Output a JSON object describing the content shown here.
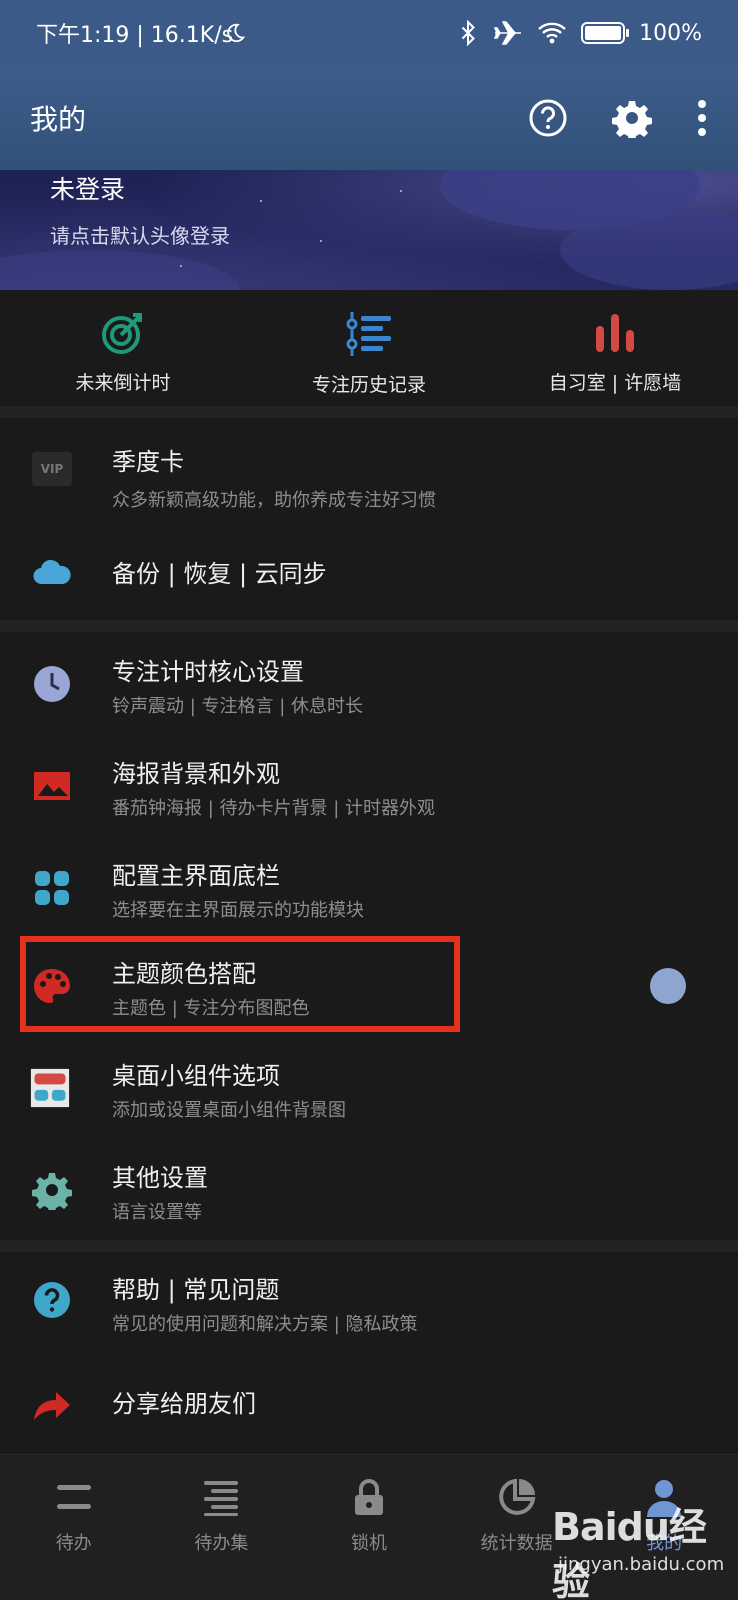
{
  "status_bar": {
    "left_text": "下午1:19 | 16.1K/s",
    "battery_text": "100%",
    "battery_level": 1.0
  },
  "app_bar": {
    "title": "我的",
    "icons": [
      "help-circle-icon",
      "settings-gear-icon",
      "more-vert-icon"
    ]
  },
  "profile": {
    "title": "未登录",
    "subtitle": "请点击默认头像登录"
  },
  "quick_actions": [
    {
      "label": "未来倒计时",
      "icon": "target-icon",
      "color": "#1e9a7a"
    },
    {
      "label": "专注历史记录",
      "icon": "timeline-list-icon",
      "color": "#3b86d1"
    },
    {
      "label": "自习室 | 许愿墙",
      "icon": "bar-chart-icon",
      "color": "#d24a42"
    }
  ],
  "group1": [
    {
      "title": "季度卡",
      "subtitle": "众多新颖高级功能，助你养成专注好习惯",
      "icon": "vip-icon"
    },
    {
      "title": "备份 | 恢复 | 云同步",
      "subtitle": "",
      "icon": "cloud-icon"
    }
  ],
  "group2": [
    {
      "title": "专注计时核心设置",
      "subtitle": "铃声震动 | 专注格言 | 休息时长",
      "icon": "clock-icon"
    },
    {
      "title": "海报背景和外观",
      "subtitle": "番茄钟海报 | 待办卡片背景 | 计时器外观",
      "icon": "image-icon"
    },
    {
      "title": "配置主界面底栏",
      "subtitle": "选择要在主界面展示的功能模块",
      "icon": "grid-icon"
    },
    {
      "title": "主题颜色搭配",
      "subtitle": "主题色 | 专注分布图配色",
      "icon": "palette-icon"
    },
    {
      "title": "桌面小组件选项",
      "subtitle": "添加或设置桌面小组件背景图",
      "icon": "widget-icon"
    },
    {
      "title": "其他设置",
      "subtitle": "语言设置等",
      "icon": "gear-icon"
    }
  ],
  "group3": [
    {
      "title": "帮助 | 常见问题",
      "subtitle": "常见的使用问题和解决方案 | 隐私政策",
      "icon": "question-icon"
    },
    {
      "title": "分享给朋友们",
      "subtitle": "",
      "icon": "share-arrow-icon"
    }
  ],
  "bottom_nav": [
    {
      "label": "待办",
      "icon": "todo-icon"
    },
    {
      "label": "待办集",
      "icon": "todo-collection-icon"
    },
    {
      "label": "锁机",
      "icon": "lock-icon"
    },
    {
      "label": "统计数据",
      "icon": "pie-chart-icon"
    },
    {
      "label": "我的",
      "icon": "person-icon",
      "active": true
    }
  ],
  "watermark": {
    "brand": "Baidu经验",
    "url": "jingyan.baidu.com"
  }
}
